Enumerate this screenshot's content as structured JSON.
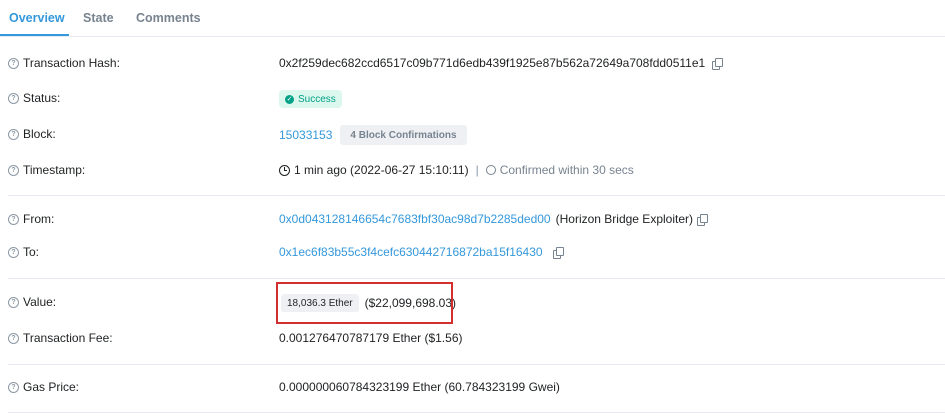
{
  "tabs": {
    "overview": "Overview",
    "state": "State",
    "comments": "Comments"
  },
  "rows": {
    "tx_hash": {
      "label": "Transaction Hash:",
      "value": "0x2f259dec682ccd6517c09b771d6edb439f1925e87b562a72649a708fdd0511e1"
    },
    "status": {
      "label": "Status:",
      "value": "Success"
    },
    "block": {
      "label": "Block:",
      "value": "15033153",
      "confirmations": "4 Block Confirmations"
    },
    "timestamp": {
      "label": "Timestamp:",
      "value": "1 min ago (2022-06-27 15:10:11)",
      "separator": "|",
      "confirmed": "Confirmed within 30 secs"
    },
    "from": {
      "label": "From:",
      "value": "0x0d043128146654c7683fbf30ac98d7b2285ded00",
      "name": "(Horizon Bridge Exploiter)"
    },
    "to": {
      "label": "To:",
      "value": "0x1ec6f83b55c3f4cefc630442716872ba15f16430"
    },
    "value": {
      "label": "Value:",
      "ether": "18,036.3 Ether",
      "usd": "($22,099,698.03)"
    },
    "fee": {
      "label": "Transaction Fee:",
      "value": "0.001276470787179 Ether ($1.56)"
    },
    "gas": {
      "label": "Gas Price:",
      "value": "0.000000060784323199 Ether (60.784323199 Gwei)"
    }
  },
  "icons": {
    "help": "question-circle-icon",
    "copy": "copy-icon",
    "check": "check-circle-icon",
    "clock": "clock-icon",
    "timer": "stopwatch-icon"
  },
  "colors": {
    "accent": "#3498db",
    "success_bg": "#dcf7ee",
    "success_text": "#00a186",
    "highlight": "#d32f2f"
  }
}
